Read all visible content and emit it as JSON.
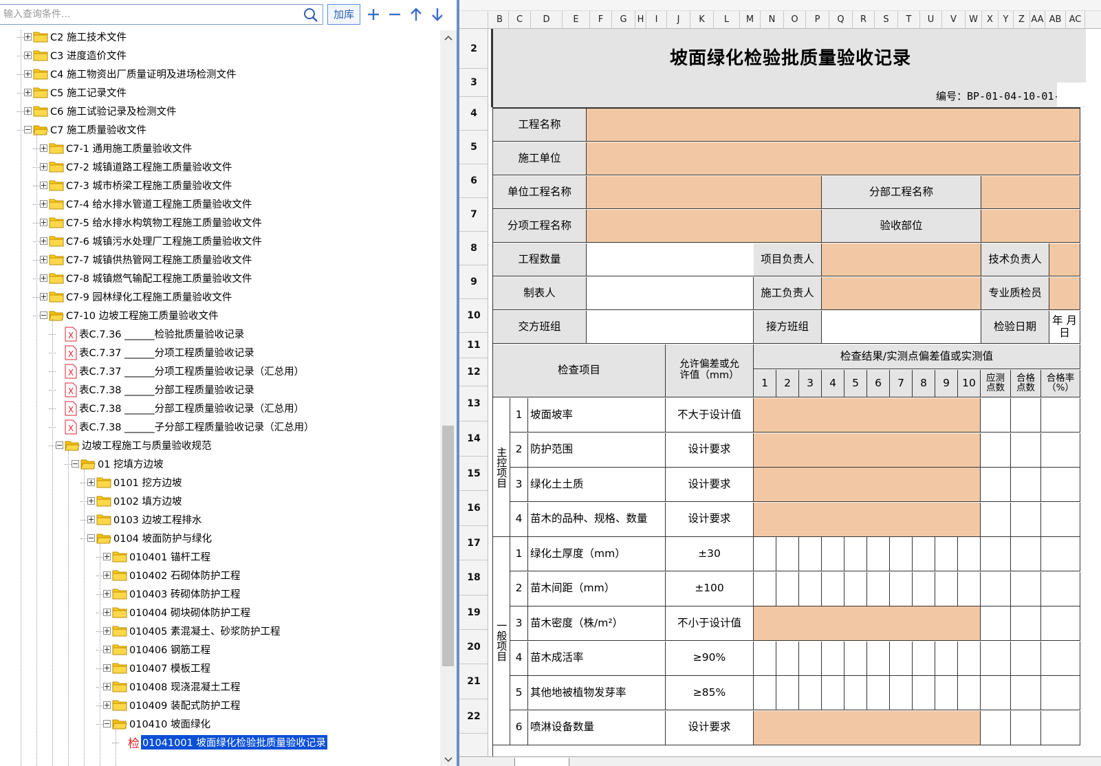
{
  "search": {
    "placeholder": "输入查询条件...",
    "add_lib_label": "加库"
  },
  "tree": {
    "items": [
      {
        "label": "C2  施工技术文件",
        "level": 1,
        "expand": "plus",
        "icon": "folder"
      },
      {
        "label": "C3  进度造价文件",
        "level": 1,
        "expand": "plus",
        "icon": "folder"
      },
      {
        "label": "C4  施工物资出厂质量证明及进场检测文件",
        "level": 1,
        "expand": "plus",
        "icon": "folder"
      },
      {
        "label": "C5  施工记录文件",
        "level": 1,
        "expand": "plus",
        "icon": "folder"
      },
      {
        "label": "C6  施工试验记录及检测文件",
        "level": 1,
        "expand": "plus",
        "icon": "folder"
      },
      {
        "label": "C7  施工质量验收文件",
        "level": 1,
        "expand": "minus",
        "icon": "folder-open"
      },
      {
        "label": "C7-1  通用施工质量验收文件",
        "level": 2,
        "expand": "plus",
        "icon": "folder"
      },
      {
        "label": "C7-2  城镇道路工程施工质量验收文件",
        "level": 2,
        "expand": "plus",
        "icon": "folder"
      },
      {
        "label": "C7-3  城市桥梁工程施工质量验收文件",
        "level": 2,
        "expand": "plus",
        "icon": "folder"
      },
      {
        "label": "C7-4  给水排水管道工程施工质量验收文件",
        "level": 2,
        "expand": "plus",
        "icon": "folder"
      },
      {
        "label": "C7-5  给水排水构筑物工程施工质量验收文件",
        "level": 2,
        "expand": "plus",
        "icon": "folder"
      },
      {
        "label": "C7-6  城镇污水处理厂工程施工质量验收文件",
        "level": 2,
        "expand": "plus",
        "icon": "folder"
      },
      {
        "label": "C7-7  城镇供热管网工程施工质量验收文件",
        "level": 2,
        "expand": "plus",
        "icon": "folder"
      },
      {
        "label": "C7-8  城镇燃气输配工程施工质量验收文件",
        "level": 2,
        "expand": "plus",
        "icon": "folder"
      },
      {
        "label": "C7-9  园林绿化工程施工质量验收文件",
        "level": 2,
        "expand": "plus",
        "icon": "folder"
      },
      {
        "label": "C7-10  边坡工程施工质量验收文件",
        "level": 2,
        "expand": "minus",
        "icon": "folder-open"
      },
      {
        "label": "表C.7.36 ______检验批质量验收记录",
        "level": 3,
        "expand": "none",
        "icon": "excel"
      },
      {
        "label": "表C.7.37 ______分项工程质量验收记录",
        "level": 3,
        "expand": "none",
        "icon": "excel"
      },
      {
        "label": "表C.7.37 ______分项工程质量验收记录（汇总用）",
        "level": 3,
        "expand": "none",
        "icon": "excel"
      },
      {
        "label": "表C.7.38 ______分部工程质量验收记录",
        "level": 3,
        "expand": "none",
        "icon": "excel"
      },
      {
        "label": "表C.7.38 ______分部工程质量验收记录（汇总用）",
        "level": 3,
        "expand": "none",
        "icon": "excel"
      },
      {
        "label": "表C.7.38 ______子分部工程质量验收记录（汇总用）",
        "level": 3,
        "expand": "none",
        "icon": "excel"
      },
      {
        "label": "边坡工程施工与质量验收规范",
        "level": 3,
        "expand": "minus",
        "icon": "folder-open"
      },
      {
        "label": "01  挖填方边坡",
        "level": 4,
        "expand": "minus",
        "icon": "folder-open"
      },
      {
        "label": "0101  挖方边坡",
        "level": 5,
        "expand": "plus",
        "icon": "folder"
      },
      {
        "label": "0102  填方边坡",
        "level": 5,
        "expand": "plus",
        "icon": "folder"
      },
      {
        "label": "0103  边坡工程排水",
        "level": 5,
        "expand": "plus",
        "icon": "folder"
      },
      {
        "label": "0104  坡面防护与绿化",
        "level": 5,
        "expand": "minus",
        "icon": "folder-open"
      },
      {
        "label": "010401  锚杆工程",
        "level": 6,
        "expand": "plus",
        "icon": "folder"
      },
      {
        "label": "010402  石砌体防护工程",
        "level": 6,
        "expand": "plus",
        "icon": "folder"
      },
      {
        "label": "010403  砖砌体防护工程",
        "level": 6,
        "expand": "plus",
        "icon": "folder"
      },
      {
        "label": "010404  砌块砌体防护工程",
        "level": 6,
        "expand": "plus",
        "icon": "folder"
      },
      {
        "label": "010405  素混凝土、砂浆防护工程",
        "level": 6,
        "expand": "plus",
        "icon": "folder"
      },
      {
        "label": "010406  钢筋工程",
        "level": 6,
        "expand": "plus",
        "icon": "folder"
      },
      {
        "label": "010407  模板工程",
        "level": 6,
        "expand": "plus",
        "icon": "folder"
      },
      {
        "label": "010408  现浇混凝土工程",
        "level": 6,
        "expand": "plus",
        "icon": "folder"
      },
      {
        "label": "010409  装配式防护工程",
        "level": 6,
        "expand": "plus",
        "icon": "folder"
      },
      {
        "label": "010410  坡面绿化",
        "level": 6,
        "expand": "minus",
        "icon": "folder-open"
      },
      {
        "label": "01041001  坡面绿化检验批质量验收记录",
        "level": 7,
        "expand": "none",
        "icon": "jian",
        "prefix": "检",
        "selected": true
      }
    ]
  },
  "sheet": {
    "columns": [
      "B",
      "C",
      "D",
      "E",
      "F",
      "G",
      "H",
      "I",
      "J",
      "K",
      "L",
      "M",
      "N",
      "O",
      "P",
      "Q",
      "R",
      "S",
      "T",
      "U",
      "V",
      "W",
      "X",
      "Y",
      "Z",
      "AA",
      "AB",
      "AC"
    ],
    "row_numbers": [
      "2",
      "3",
      "4",
      "5",
      "6",
      "7",
      "8",
      "9",
      "10",
      "11",
      "12",
      "13",
      "14",
      "15",
      "16",
      "17",
      "18",
      "19",
      "20",
      "21",
      "22"
    ],
    "title": "坡面绿化检验批质量验收记录",
    "doc_no": "编号：BP-01-04-10-01-",
    "labels": {
      "project_name": "工程名称",
      "construction_unit": "施工单位",
      "unit_project_name": "单位工程名称",
      "division_project_name": "分部工程名称",
      "subitem_project_name": "分项工程名称",
      "acceptance_location": "验收部位",
      "quantity": "工程数量",
      "project_leader": "项目负责人",
      "tech_leader": "技术负责人",
      "preparer": "制表人",
      "construction_leader": "施工负责人",
      "quality_inspector": "专业质检员",
      "handover_team": "交方班组",
      "receiver_team": "接方班组",
      "inspection_date": "检验日期",
      "date_value": "年    月    日",
      "check_item": "检查项目",
      "tolerance": "允许偏差或允许值（mm）",
      "results": "检查结果/实测点偏差值或实测值",
      "should_points": "应测点数",
      "pass_points": "合格点数",
      "pass_rate": "合格率（%）",
      "main_items": "主控项目",
      "general_items": "一般项目"
    },
    "measure_cols": [
      "1",
      "2",
      "3",
      "4",
      "5",
      "6",
      "7",
      "8",
      "9",
      "10"
    ],
    "main_rows": [
      {
        "no": "1",
        "item": "坡面坡率",
        "value": "不大于设计值"
      },
      {
        "no": "2",
        "item": "防护范围",
        "value": "设计要求"
      },
      {
        "no": "3",
        "item": "绿化土土质",
        "value": "设计要求"
      },
      {
        "no": "4",
        "item": "苗木的品种、规格、数量",
        "value": "设计要求"
      }
    ],
    "general_rows": [
      {
        "no": "1",
        "item": "绿化土厚度（mm）",
        "value": "±30",
        "fill": "grid"
      },
      {
        "no": "2",
        "item": "苗木间距（mm）",
        "value": "±100",
        "fill": "grid"
      },
      {
        "no": "3",
        "item": "苗木密度（株/m²）",
        "value": "不小于设计值",
        "fill": "orange"
      },
      {
        "no": "4",
        "item": "苗木成活率",
        "value": "≥90%",
        "fill": "grid"
      },
      {
        "no": "5",
        "item": "其他地被植物发芽率",
        "value": "≥85%",
        "fill": "grid"
      },
      {
        "no": "6",
        "item": "喷淋设备数量",
        "value": "设计要求",
        "fill": "orange"
      }
    ]
  }
}
